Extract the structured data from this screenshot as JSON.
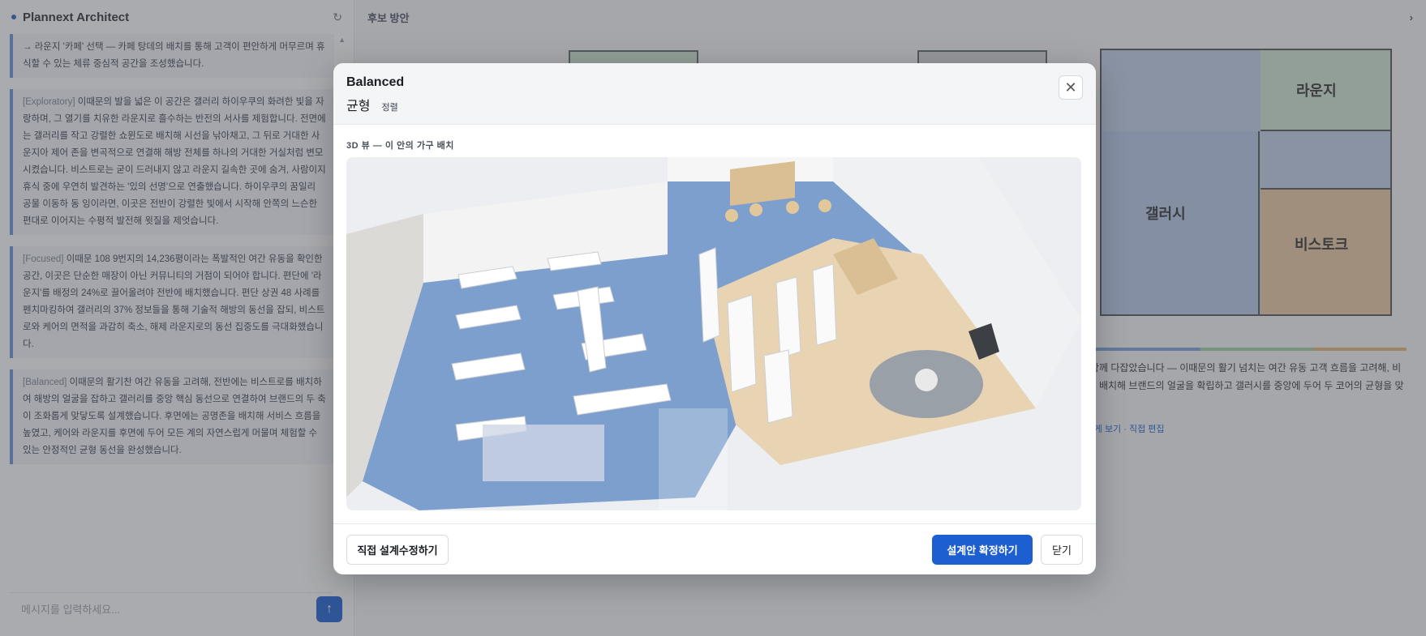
{
  "app": {
    "title": "Plannext Architect",
    "right_title": "후보 방안",
    "composer_placeholder": "메시지를 입력하세요..."
  },
  "chat": {
    "messages": [
      {
        "tag": "",
        "text": "→ 라운지 '카페' 선택 — 카페 탕데의 배치를 통해 고객이 편안하게 머무르며 휴식할 수 있는 체류 중심적 공간을 조성했습니다."
      },
      {
        "tag": "[Exploratory]",
        "text": "이때문의 발을 넓은 이 공간은 갤러리 하이우쿠의 화려한 빛을 자랑하며, 그 열기를 치유한 라운지로 흘수하는 반전의 서사를 제험합니다. 전면에는 갤러리를 작고 강렬한 쇼윈도로 배치해 시선을 낚아채고, 그 뒤로 거대한 사운지아 제어 존을 변곡적으로 연결해 해방 전체를 하나의 거대한 거실처럼 변모시켰습니다. 비스트로는 굳이 드러내지 않고 라운지 길속한 곳에 숨겨, 사람이지 휴식 중에 우연히 발견하는 '있의 선명'으로 연출했습니다. 하이우쿠의 꿈일리 공물 이동하 동 잉이라면, 이곳은 전반이 강렬한 빛에서 시작해 안쪽의 느슨한 편대로 이어지는 수평적 발전해 윗질을 제엇습니다."
      },
      {
        "tag": "[Focused]",
        "text": "이때문 108 9번지의 14,236평이라는 폭발적인 여간 유동을 확인한 공간, 이곳은 단순한 매장이 아닌 커뮤니티의 거점이 되어야 합니다. 편단에 '라운지'를 배정의 24%로 끌어올려야 전반에 배치했습니다. 편단 상권 48 사례를 펜치마킹하여 갤러리의 37% 정보들을 통해 기술적 해방의 동선을 잡되, 비스트로와 케어의 면적을 과감히 축소, 해제 라운지로의 동선 집중도를 극대화했습니다."
      },
      {
        "tag": "[Balanced]",
        "text": "이때문의 활기찬 여간 유동을 고려해, 전반에는 비스트로를 배치하여 해방의 얼굴을 잡하고 갤러리를 중앙 핵심 동선으로 연결하여 브랜드의 두 축이 조화롭게 맞닿도록 설계했습니다. 후면에는 공명존을 배치해 서비스 흐름을 높였고, 케어와 라운지를 후면에 두어 모든 계의 자연스럽게 머물며 체험할 수 있는 안정적인 균형 동선을 완성했습니다."
      }
    ]
  },
  "right_panel": {
    "floorplan_labels": {
      "lounge": "라운지",
      "gallery": "갤러시",
      "bistro": "비스토크"
    },
    "summary_title": "Balanced 균형",
    "summary_text": "해방의 활기와 함께 다잡았습니다 — 이때문의 활기 넘치는 여간 유동 고객 흐름을 고려해, 비스트로를 전면에 배치해 브랜드의 얼굴을 확립하고 갤러시를 중앙에 두어 두 코어의 균형을 맞췄습니다.",
    "link": "결함 → 3D 뷰 크게 보기 · 직접 편집"
  },
  "modal": {
    "title": "Balanced",
    "subtitle": "균형",
    "badge": "정렬",
    "section_label": "3D 뷰 — 이 안의 가구 배치",
    "buttons": {
      "edit": "직접 설계수정하기",
      "confirm": "설계안 확정하기",
      "close": "닫기"
    }
  }
}
